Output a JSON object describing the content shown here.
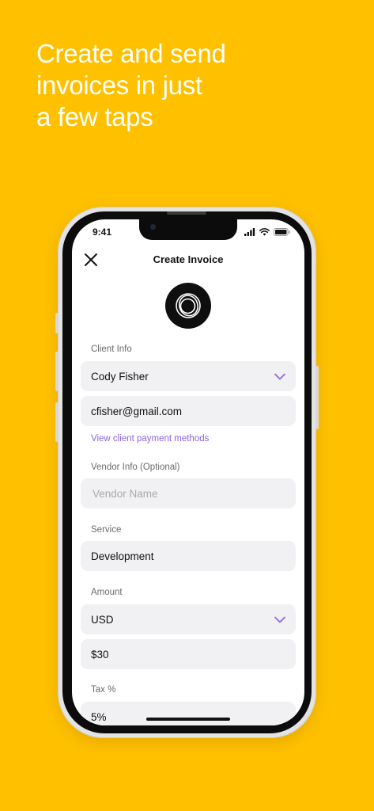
{
  "headline": {
    "line1": "Create and send",
    "line2": "invoices in just",
    "line3": "a few taps"
  },
  "status_bar": {
    "time": "9:41"
  },
  "nav": {
    "title": "Create Invoice"
  },
  "client_info": {
    "label": "Client Info",
    "client_name": "Cody Fisher",
    "email": "cfisher@gmail.com",
    "payment_link": "View client payment methods"
  },
  "vendor_info": {
    "label": "Vendor Info (Optional)",
    "placeholder": "Vendor Name"
  },
  "service": {
    "label": "Service",
    "value": "Development"
  },
  "amount": {
    "label": "Amount",
    "currency": "USD",
    "value": "$30"
  },
  "tax": {
    "label": "Tax %",
    "value": "5%"
  },
  "colors": {
    "background": "#FFC000",
    "accent": "#8A63E4",
    "field_bg": "#F1F1F3"
  },
  "icons": {
    "close": "close-icon",
    "chevron": "chevron-down-icon",
    "logo": "company-logo"
  }
}
